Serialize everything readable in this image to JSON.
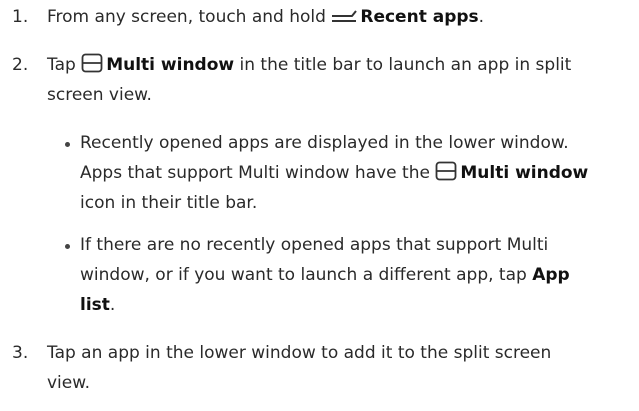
{
  "steps": [
    {
      "number": "1.",
      "lines": [
        {
          "pre": "From any screen, touch and hold",
          "icon": "recent-apps-icon",
          "bold": "Recent apps",
          "post": "."
        }
      ]
    },
    {
      "number": "2.",
      "line1_pre": "Tap",
      "line1_icon": "multi-window-icon",
      "line1_bold": "Multi window",
      "line1_post": "in the title bar to launch an app in split",
      "line2": "screen view."
    },
    {
      "number": "3.",
      "line1": "Tap an app in the lower window to add it to the split screen",
      "line2": "view."
    }
  ],
  "bullets": [
    {
      "line1": "Recently opened apps are displayed in the lower window.",
      "line2_pre": "Apps that support Multi window have the",
      "line2_icon": "multi-window-icon",
      "line2_bold": "Multi window",
      "line3": "icon in their title bar."
    },
    {
      "line1": "If there are no recently opened apps that support Multi",
      "line2_pre": "window, or if you want to launch a different app, tap",
      "line2_bold": "App",
      "line3_bold": "list",
      "line3_post": "."
    }
  ]
}
